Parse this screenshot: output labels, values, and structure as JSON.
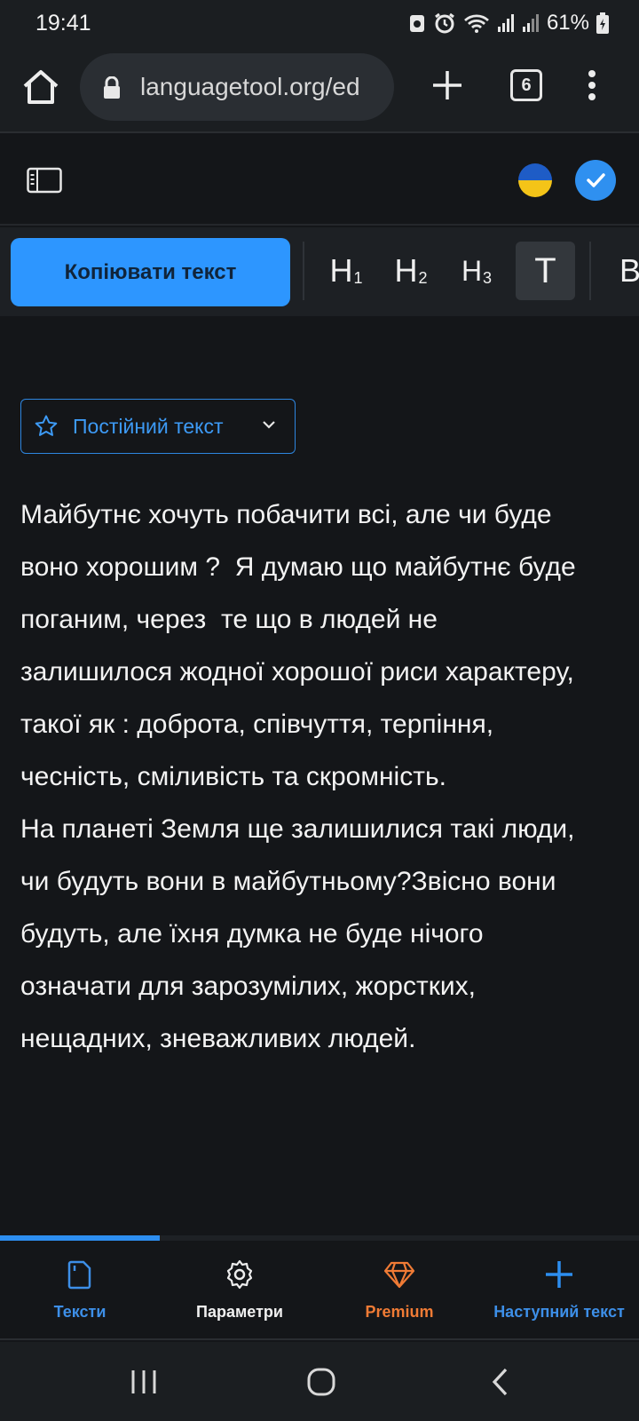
{
  "status": {
    "time": "19:41",
    "battery": "61%"
  },
  "browser": {
    "url": "languagetool.org/ed",
    "tab_count": "6"
  },
  "toolbar": {
    "copy_label": "Копіювати текст",
    "h1": "H",
    "h2": "H",
    "h3": "H",
    "h1_sub": "1",
    "h2_sub": "2",
    "h3_sub": "3",
    "text_btn": "T",
    "bold": "B"
  },
  "editor": {
    "text_type": "Постійний текст",
    "paragraphs": [
      "Майбутнє хочуть побачити всі, але чи буде\nвоно хорошим ?  Я думаю що майбутнє буде\nпоганим, через  те що в людей не\nзалишилося жодної хорошої риси характеру,\nтакої як : доброта, співчуття, терпіння,\nчесність, сміливість та скромність.",
      "На планеті Земля ще залишилися такі люди,\nчи будуть вони в майбутньому?Звісно вони\nбудуть, але їхня думка не буде нічого\nозначати для зарозумілих, жорстких,\nнещадних, зневажливих людей."
    ]
  },
  "progress": 0.25,
  "nav": {
    "texts": "Тексти",
    "settings": "Параметри",
    "premium": "Premium",
    "next": "Наступний текст"
  },
  "colors": {
    "accent": "#2d96ff",
    "premium": "#f07b35",
    "background": "#141619"
  }
}
